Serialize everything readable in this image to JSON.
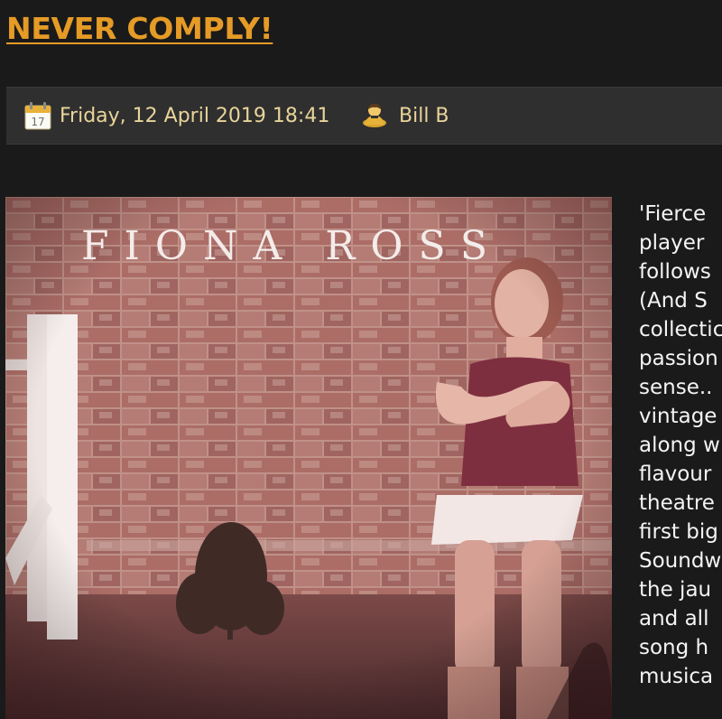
{
  "article": {
    "title": "NEVER COMPLY!",
    "date": "Friday, 12 April 2019 18:41",
    "author": "Bill B"
  },
  "calendar_icon_number": "17",
  "album_cover": {
    "artist_title": "FIONA ROSS"
  },
  "body_lines": [
    "'Fierce",
    "player",
    "follows",
    "(And  S",
    "collectic",
    "passion",
    "sense..",
    "vintage",
    "along  w",
    "flavour",
    "theatre",
    "first  big",
    "Soundw",
    "the jau",
    "and  all",
    "song  h",
    "musica"
  ],
  "colors": {
    "background": "#1a1a1a",
    "title": "#e59b26",
    "meta_bar": "#2f2f2f",
    "meta_text": "#e9d49a",
    "body_text": "#f4f4f4"
  }
}
